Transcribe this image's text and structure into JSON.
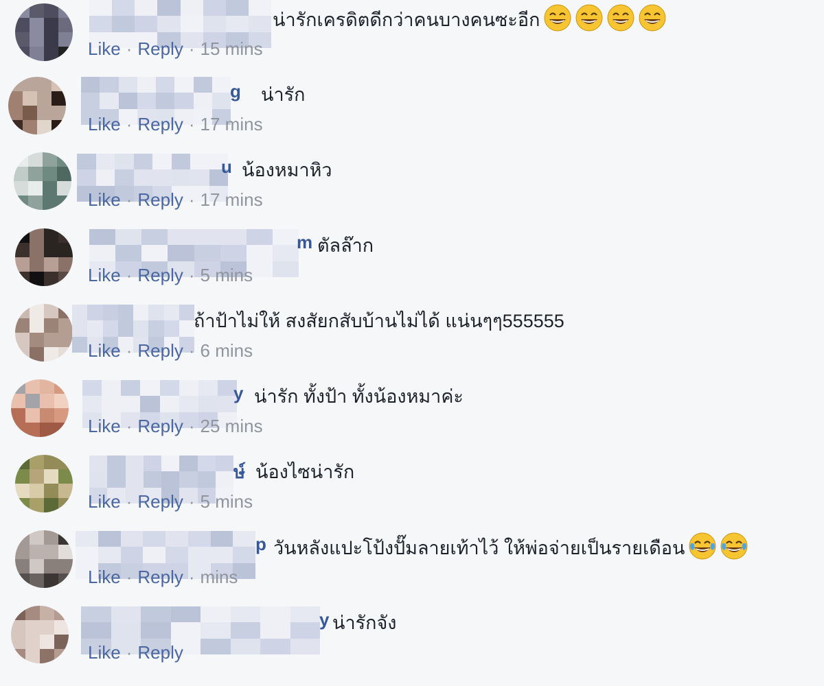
{
  "comments": [
    {
      "name_tail": "",
      "text": "น่ารักเครดิตดีกว่าคนบางคนซะอีก",
      "emoji": "grin",
      "emoji_count": 4,
      "like": "Like",
      "reply": "Reply",
      "time": "15 mins"
    },
    {
      "name_tail": "g",
      "text": "น่ารัก",
      "emoji": "",
      "emoji_count": 0,
      "like": "Like",
      "reply": "Reply",
      "time": "17 mins"
    },
    {
      "name_tail": "u",
      "text": "น้องหมาหิว",
      "emoji": "",
      "emoji_count": 0,
      "like": "Like",
      "reply": "Reply",
      "time": "17 mins"
    },
    {
      "name_tail": "m",
      "text": "ตัลล๊าก",
      "emoji": "",
      "emoji_count": 0,
      "like": "Like",
      "reply": "Reply",
      "time": "5 mins"
    },
    {
      "name_tail": "",
      "text": "ถ้าป้าไม่ให้ สงสัยกสับบ้านไม่ได้ แน่นๆๆ555555",
      "emoji": "",
      "emoji_count": 0,
      "like": "Like",
      "reply": "Reply",
      "time": "6 mins"
    },
    {
      "name_tail": "y",
      "text": "น่ารัก ทั้งป้า ทั้งน้องหมาค่ะ",
      "emoji": "",
      "emoji_count": 0,
      "like": "Like",
      "reply": "Reply",
      "time": "25 mins"
    },
    {
      "name_tail": "ษ์",
      "text": "น้องไซน่ารัก",
      "emoji": "",
      "emoji_count": 0,
      "like": "Like",
      "reply": "Reply",
      "time": "5 mins"
    },
    {
      "name_tail": "p",
      "text": "วันหลังแปะโป้งปั๊มลายเท้าไว้ ให้พ่อจ่ายเป็นรายเดือน",
      "emoji": "joy",
      "emoji_count": 2,
      "like": "Like",
      "reply": "Reply",
      "time": "mins"
    },
    {
      "name_tail": "y",
      "text": "น่ารักจัง",
      "emoji": "",
      "emoji_count": 0,
      "like": "Like",
      "reply": "Reply",
      "time": ""
    }
  ],
  "colors": {
    "name": "#365899",
    "meta": "#90949c",
    "link": "#4b67a1",
    "bg": "#f6f7f9"
  }
}
